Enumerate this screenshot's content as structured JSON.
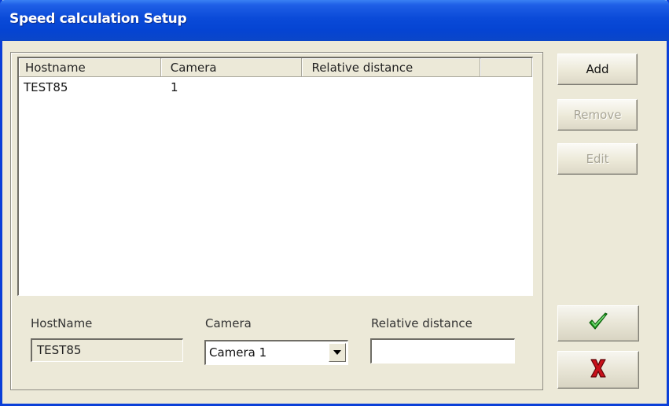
{
  "window": {
    "title": "Speed calculation Setup"
  },
  "list": {
    "columns": [
      "Hostname",
      "Camera",
      "Relative distance",
      ""
    ],
    "rows": [
      {
        "hostname": "TEST85",
        "camera": "1",
        "distance": ""
      }
    ]
  },
  "form": {
    "hostname_label": "HostName",
    "hostname_value": "TEST85",
    "camera_label": "Camera",
    "camera_value": "Camera 1",
    "distance_label": "Relative distance",
    "distance_value": ""
  },
  "buttons": {
    "add": "Add",
    "remove": "Remove",
    "edit": "Edit"
  },
  "icons": {
    "ok": "green-checkmark-icon",
    "cancel": "red-x-icon",
    "dropdown": "chevron-down-icon"
  },
  "colors": {
    "titlebar": "#0a4ad8",
    "window_bg": "#ece9d8",
    "ok_green": "#1f9a1f",
    "cancel_red": "#c8101a"
  }
}
